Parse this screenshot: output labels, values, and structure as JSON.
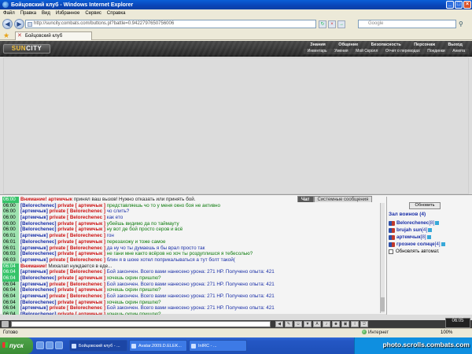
{
  "window": {
    "title": "Бойцовский клуб - Windows Internet Explorer"
  },
  "menu": [
    "Файл",
    "Правка",
    "Вид",
    "Избранное",
    "Сервис",
    "Справка"
  ],
  "address": {
    "url": "http://suncity.combats.com/buttons.pl?battle=0.9422797650756006",
    "search_placeholder": "Google"
  },
  "tab": {
    "label": "Бойцовский клуб"
  },
  "game": {
    "logo_prefix": "SUN",
    "logo_suffix": "CITY",
    "nav_row1": [
      "Знания",
      "Общение",
      "Безопасность",
      "Персонаж",
      "Выход"
    ],
    "nav_row2": [
      "Инвентарь",
      "Умения",
      "Мой Скролл",
      "Отчет о переводах",
      "Поединки",
      "Анкета"
    ]
  },
  "chat": {
    "tab_chat": "Чат",
    "tab_system": "Системные сообщения",
    "messages": [
      {
        "time": "06:00",
        "nick": "Внимание!",
        "priv": "",
        "target": "артемчык",
        "text": "принял ваш вызов! Нужно отказать или принять бой.",
        "color": "dark",
        "hl": true,
        "type": "system"
      },
      {
        "time": "06:00",
        "nick": "[Belorechenec]",
        "priv": "private",
        "target": "[ артемчык ]",
        "text": "представляешь чо то у меня окно боя не активно",
        "color": "green",
        "hl": false,
        "type": "private"
      },
      {
        "time": "06:00",
        "nick": "[артемчык]",
        "priv": "private",
        "target": "[ Belorechenec ]",
        "text": "чо слить?",
        "color": "blue",
        "hl": false,
        "type": "private"
      },
      {
        "time": "06:00",
        "nick": "[артемчык]",
        "priv": "private",
        "target": "[ Belorechenec ]",
        "text": "как ето",
        "color": "blue",
        "hl": false,
        "type": "private"
      },
      {
        "time": "06:00",
        "nick": "[Belorechenec]",
        "priv": "private",
        "target": "[ артемчык ]",
        "text": "убейшь видимо да по таймауту",
        "color": "green",
        "hl": false,
        "type": "private"
      },
      {
        "time": "06:00",
        "nick": "[Belorechenec]",
        "priv": "private",
        "target": "[ артемчык ]",
        "text": "ну вот де бой просто серов и всё",
        "color": "green",
        "hl": false,
        "type": "private"
      },
      {
        "time": "06:01",
        "nick": "[артемчык]",
        "priv": "private",
        "target": "[ Belorechenec ]",
        "text": "гон",
        "color": "blue",
        "hl": false,
        "type": "private"
      },
      {
        "time": "06:01",
        "nick": "[Belorechenec]",
        "priv": "private",
        "target": "[ артемчык ]",
        "text": "перезахожу и тоже самое",
        "color": "green",
        "hl": false,
        "type": "private"
      },
      {
        "time": "06:01",
        "nick": "[артемчык]",
        "priv": "private",
        "target": "[ Belorechenec ]",
        "text": "да ну чо ты думаешь я бы врал просто так",
        "color": "blue",
        "hl": false,
        "type": "private"
      },
      {
        "time": "06:03",
        "nick": "[Belorechenec]",
        "priv": "private",
        "target": "[ артемчык ]",
        "text": "не гани мне както всёров но хоч ты роздуплишся я тебесолью?",
        "color": "green",
        "hl": false,
        "type": "private"
      },
      {
        "time": "06:03",
        "nick": "[артемчык]",
        "priv": "private",
        "target": "[ Belorechenec ]",
        "text": "блин я в шоке хотел поприкалываться а тут болт такой(",
        "color": "blue",
        "hl": false,
        "type": "private"
      },
      {
        "time": "06:04",
        "nick": "Внимание!",
        "priv": "",
        "target": "",
        "text": "Михалап нуждается в еде...",
        "color": "dark",
        "hl": true,
        "type": "system"
      },
      {
        "time": "06:04",
        "nick": "[артемчык]",
        "priv": "private",
        "target": "[ Belorechenec ]",
        "text": "Бой закончен. Всего вами нанесено урона: 271 HP. Получено опыта: 421",
        "color": "blue",
        "hl": true,
        "type": "private"
      },
      {
        "time": "06:04",
        "nick": "[Belorechenec]",
        "priv": "private",
        "target": "[ артемчык ]",
        "text": "хочешь скрин пришлю?",
        "color": "green",
        "hl": true,
        "type": "private"
      },
      {
        "time": "06:04",
        "nick": "[артемчык]",
        "priv": "private",
        "target": "[ Belorechenec ]",
        "text": "Бой закончен. Всего вами нанесено урона: 271 HP. Получено опыта: 421",
        "color": "blue",
        "hl": false,
        "type": "private"
      },
      {
        "time": "06:04",
        "nick": "[Belorechenec]",
        "priv": "private",
        "target": "[ артемчык ]",
        "text": "хочешь скрин пришлю?",
        "color": "green",
        "hl": false,
        "type": "private"
      },
      {
        "time": "06:04",
        "nick": "[артемчык]",
        "priv": "private",
        "target": "[ Belorechenec ]",
        "text": "Бой закончен. Всего вами нанесено урона: 271 HP. Получено опыта: 421",
        "color": "blue",
        "hl": false,
        "type": "private"
      },
      {
        "time": "06:04",
        "nick": "[Belorechenec]",
        "priv": "private",
        "target": "[ артемчык ]",
        "text": "хочешь скрин пришлю?",
        "color": "green",
        "hl": false,
        "type": "private"
      },
      {
        "time": "06:04",
        "nick": "[артемчык]",
        "priv": "private",
        "target": "[ Belorechenec ]",
        "text": "Бой закончен. Всего вами нанесено урона: 271 HP. Получено опыта: 421",
        "color": "blue",
        "hl": false,
        "type": "private"
      },
      {
        "time": "06:04",
        "nick": "[Belorechenec]",
        "priv": "private",
        "target": "[ артемчык ]",
        "text": "хочешь скрин пришлю?",
        "color": "green",
        "hl": false,
        "type": "private"
      }
    ]
  },
  "room": {
    "refresh_label": "Обновить",
    "title": "Зал воинов (4)",
    "players": [
      {
        "name": "Belorechenec",
        "level": "[8]"
      },
      {
        "name": "brujah sun",
        "level": "[4]"
      },
      {
        "name": "артемчык",
        "level": "[8]"
      },
      {
        "name": "грозное солнце",
        "level": "[4]"
      }
    ],
    "auto_refresh_label": "Обновлять автомат."
  },
  "chat_bar": {
    "clock": "06:05"
  },
  "status": {
    "left": "Готово",
    "zone": "Интернет",
    "zoom": "100%"
  },
  "taskbar": {
    "start_label": "пуск",
    "tasks": [
      "Бойцовский клуб - ...",
      "Avatar.2009.D.ELEK...",
      "InIRC - ...",
      "Narkom..."
    ],
    "watermark": "photo.scrolls.combats.com"
  },
  "colors": {
    "green": "#0b7a0b",
    "blue": "#1a2fa8",
    "red": "#cc1111",
    "dark": "#222222"
  }
}
